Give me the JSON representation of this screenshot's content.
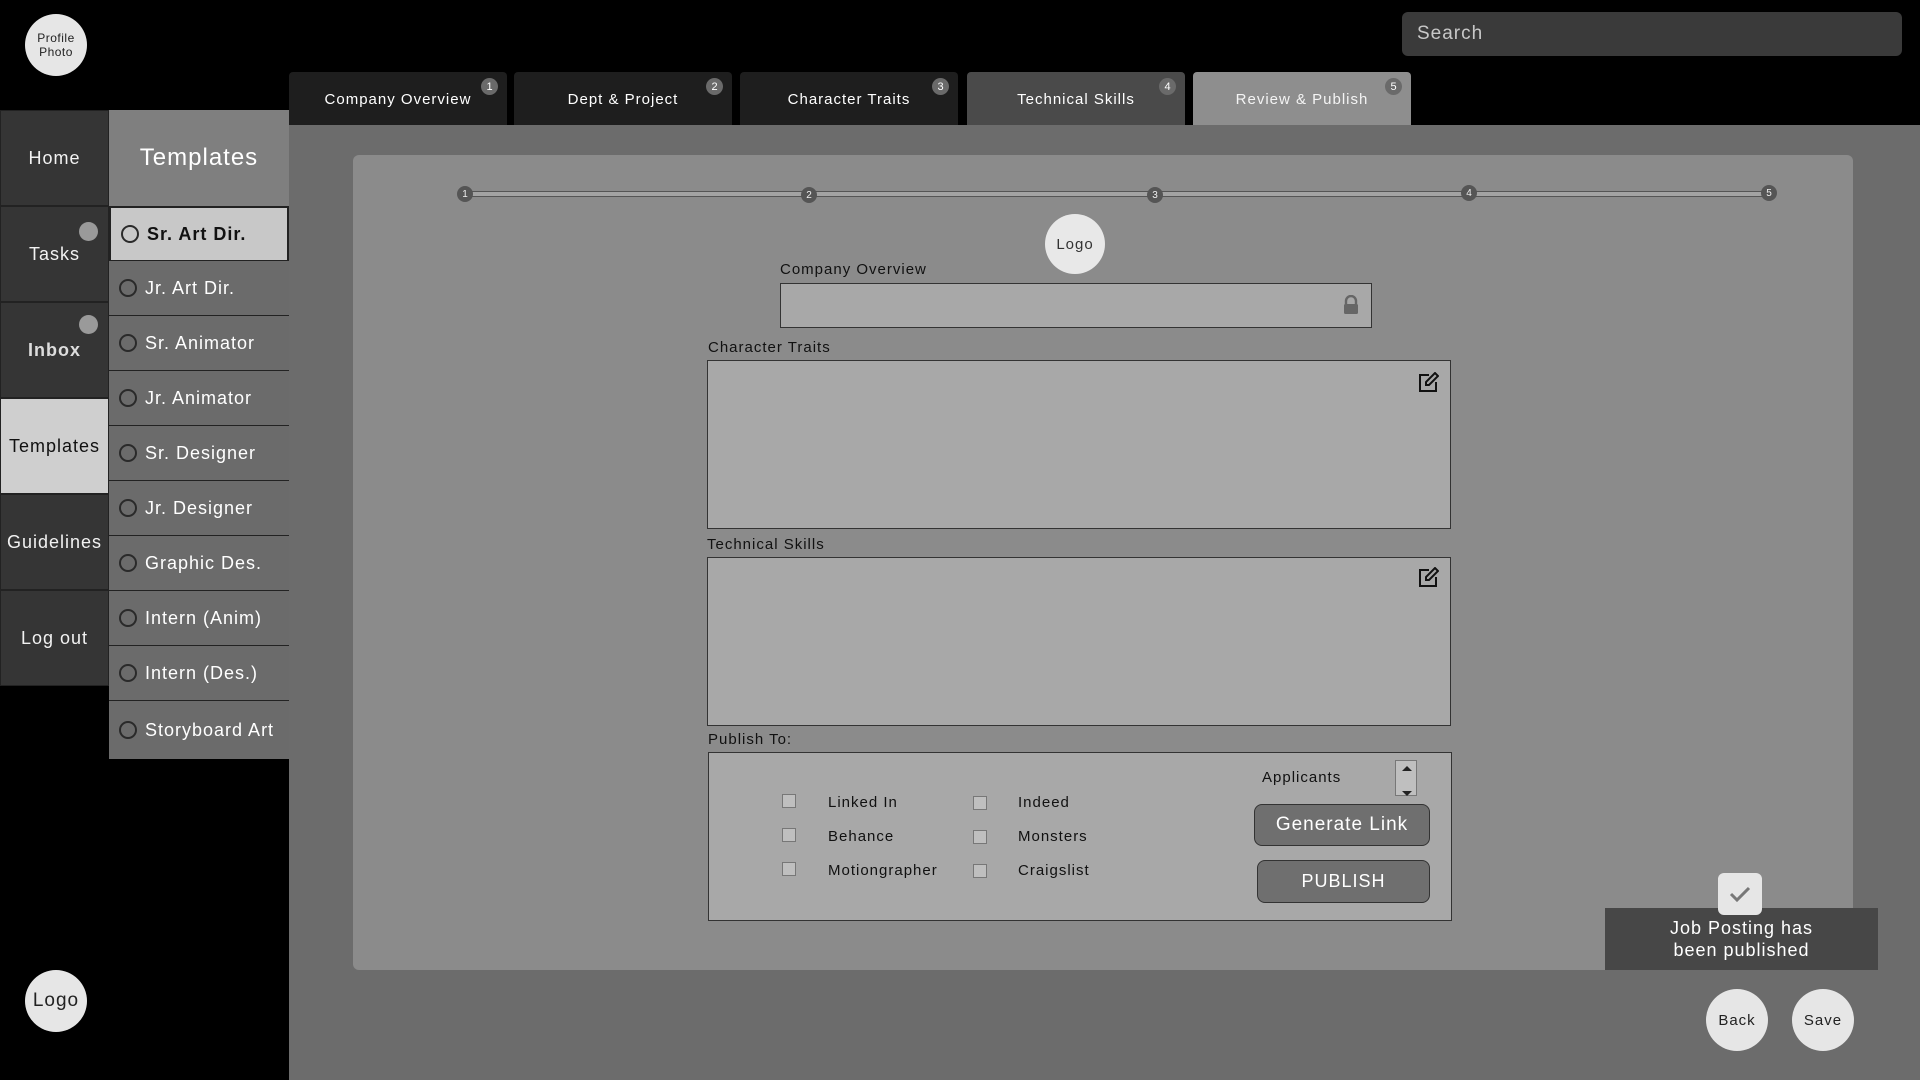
{
  "profile": {
    "label_line1": "Profile",
    "label_line2": "Photo"
  },
  "search": {
    "placeholder": "Search"
  },
  "tabs": [
    {
      "label": "Company Overview",
      "num": "1"
    },
    {
      "label": "Dept & Project",
      "num": "2"
    },
    {
      "label": "Character Traits",
      "num": "3"
    },
    {
      "label": "Technical Skills",
      "num": "4"
    },
    {
      "label": "Review & Publish",
      "num": "5"
    }
  ],
  "nav": {
    "home": "Home",
    "tasks": "Tasks",
    "inbox": "Inbox",
    "templates": "Templates",
    "guidelines": "Guidelines",
    "logout": "Log out"
  },
  "templates": {
    "header": "Templates",
    "items": [
      "Sr. Art Dir.",
      "Jr. Art Dir.",
      "Sr. Animator",
      "Jr. Animator",
      "Sr. Designer",
      "Jr. Designer",
      "Graphic Des.",
      "Intern (Anim)",
      "Intern (Des.)",
      "Storyboard Art"
    ]
  },
  "logo": "Logo",
  "steps": [
    "1",
    "2",
    "3",
    "4",
    "5"
  ],
  "form": {
    "company_label": "Company Overview",
    "traits_label": "Character Traits",
    "skills_label": "Technical Skills",
    "publish_label": "Publish To:",
    "applicants_label": "Applicants",
    "platforms_col1": [
      "Linked In",
      "Behance",
      "Motiongrapher"
    ],
    "platforms_col2": [
      "Indeed",
      "Monsters",
      "Craigslist"
    ],
    "generate_link": "Generate Link",
    "publish": "PUBLISH"
  },
  "toast": {
    "line1": "Job Posting has",
    "line2": "been published"
  },
  "buttons": {
    "back": "Back",
    "save": "Save"
  },
  "icons": {
    "lock": "lock-icon",
    "edit": "edit-icon",
    "check": "check-icon"
  }
}
